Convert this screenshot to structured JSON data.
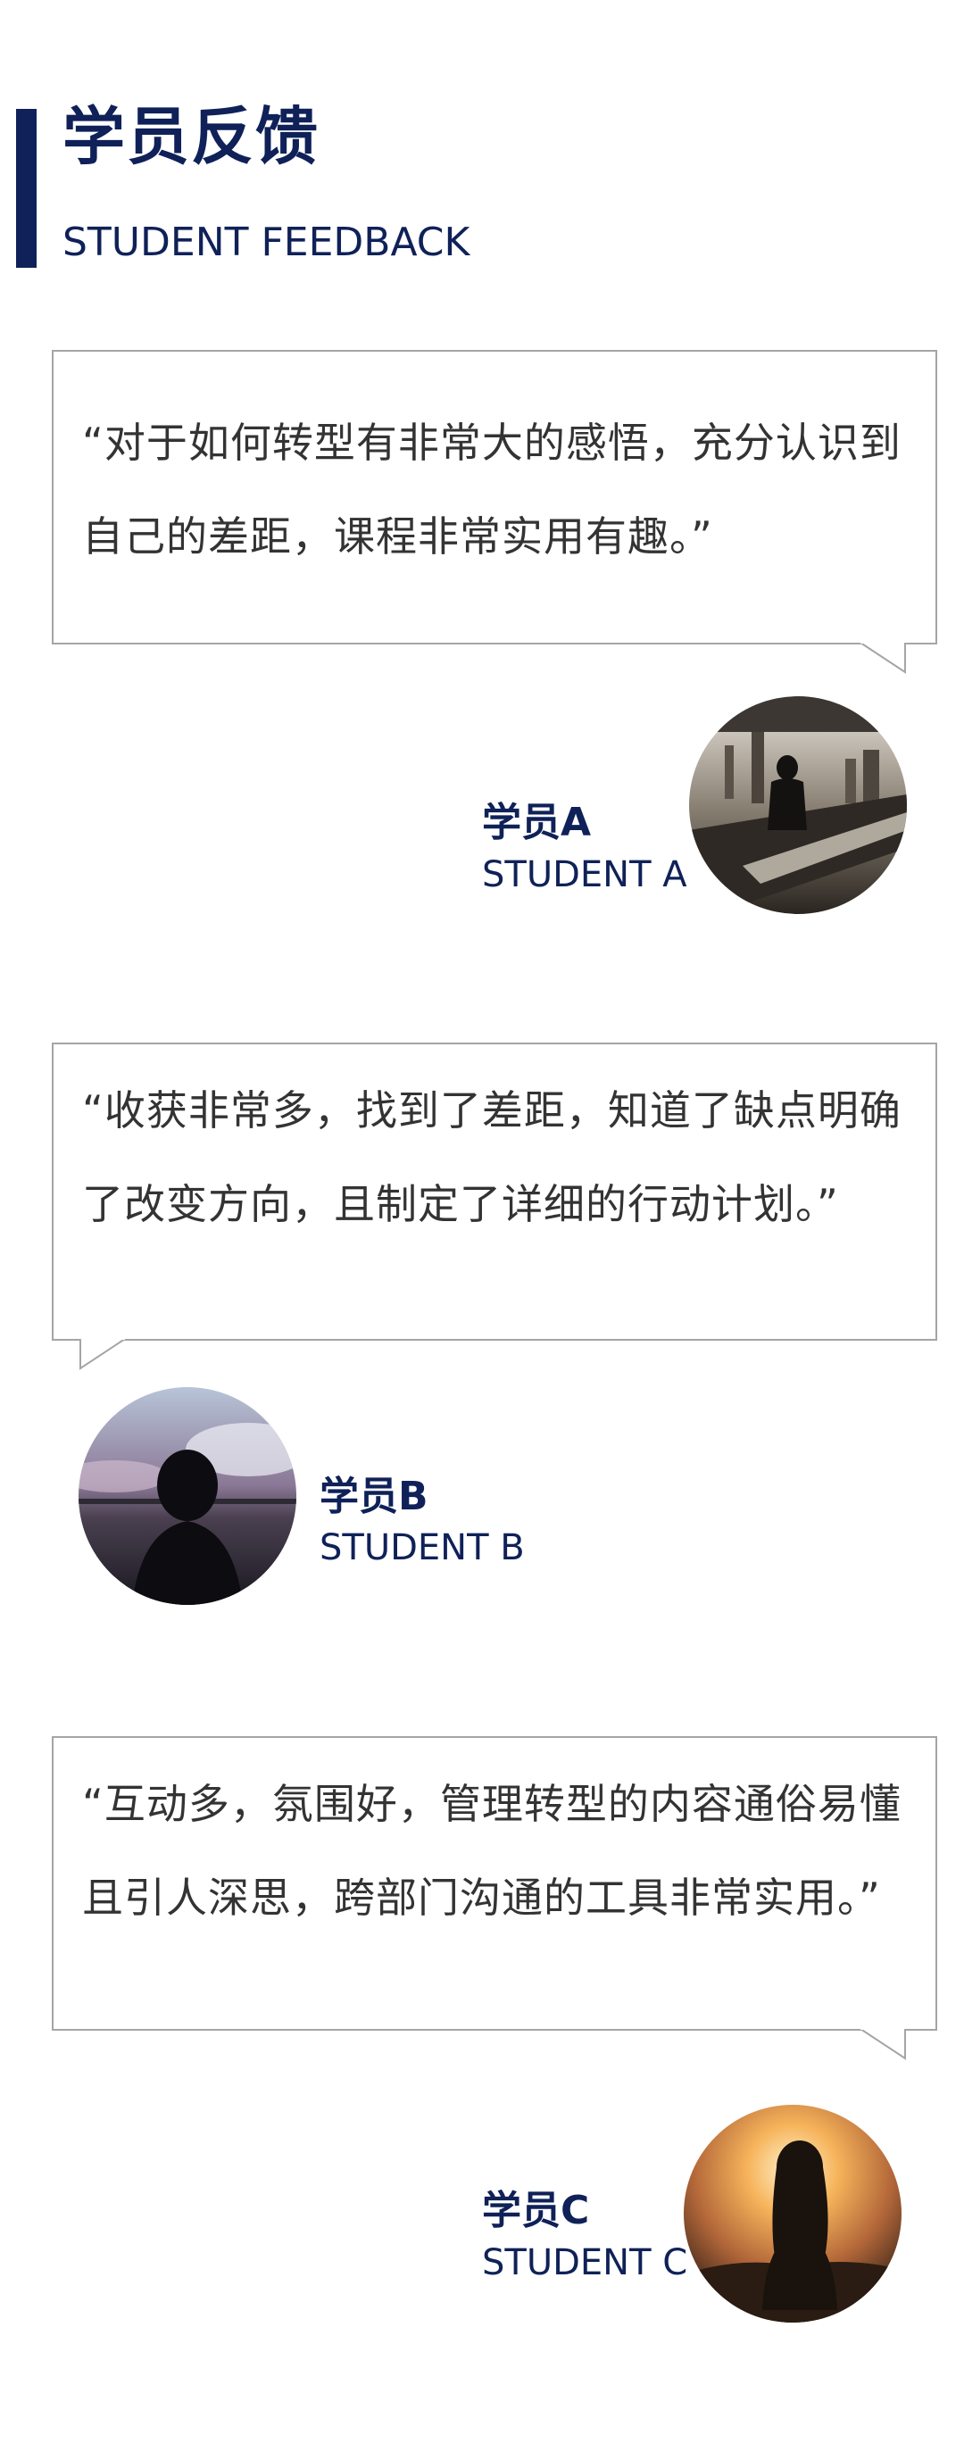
{
  "header": {
    "title": "学员反馈",
    "subtitle": "STUDENT FEEDBACK"
  },
  "feedback": [
    {
      "quote": "“对于如何转型有非常大的感悟，充分认识到自己的差距，课程非常实用有趣。”",
      "name": "学员A",
      "name_en": "STUDENT A",
      "avatar": "businessman-silhouette-office-photo"
    },
    {
      "quote": "“收获非常多，找到了差距，知道了缺点明确了改变方向，且制定了详细的行动计划。”",
      "name": "学员B",
      "name_en": "STUDENT B",
      "avatar": "woman-silhouette-lakeside-photo"
    },
    {
      "quote": "“互动多，氛围好，管理转型的内容通俗易懂且引人深思，跨部门沟通的工具非常实用。”",
      "name": "学员C",
      "name_en": "STUDENT C",
      "avatar": "woman-silhouette-sunset-photo"
    }
  ],
  "colors": {
    "navy": "#0f2158",
    "border": "#a5a5a5",
    "text": "#333333"
  }
}
